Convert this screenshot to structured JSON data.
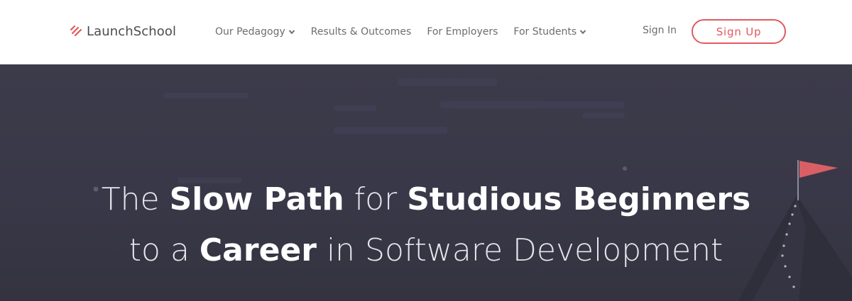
{
  "navbar": {
    "logo_text": "LaunchSchool",
    "links": [
      {
        "label": "Our Pedagogy",
        "has_dropdown": true
      },
      {
        "label": "Results & Outcomes",
        "has_dropdown": false
      },
      {
        "label": "For Employers",
        "has_dropdown": false
      },
      {
        "label": "For Students",
        "has_dropdown": true
      }
    ],
    "sign_in": "Sign In",
    "sign_up": "Sign Up"
  },
  "hero": {
    "line1": [
      {
        "text": "The ",
        "weight": "light"
      },
      {
        "text": "Slow Path",
        "weight": "bold"
      },
      {
        "text": " for ",
        "weight": "light"
      },
      {
        "text": "Studious Beginners",
        "weight": "bold"
      }
    ],
    "line2": [
      {
        "text": "to a ",
        "weight": "light"
      },
      {
        "text": "Career",
        "weight": "bold"
      },
      {
        "text": " in Software Development",
        "weight": "light"
      }
    ]
  },
  "colors": {
    "brand_red": "#e05a5e",
    "hero_bg": "#3a3948",
    "nav_text": "#6d6d74"
  },
  "icons": [
    "launchschool-logo-icon",
    "chevron-down-icon",
    "mountain-flag-icon"
  ]
}
